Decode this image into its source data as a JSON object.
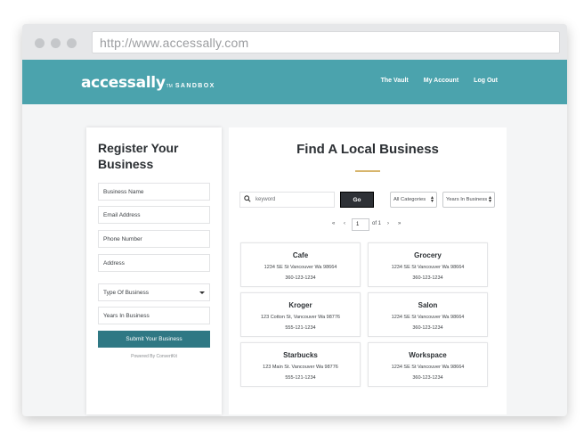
{
  "browser": {
    "url": "http://www.accessally.com"
  },
  "header": {
    "logo_text": "accessally",
    "logo_tm": "TM",
    "logo_sub": "SANDBOX",
    "nav": [
      "The Vault",
      "My Account",
      "Log Out"
    ]
  },
  "register": {
    "title": "Register Your Business",
    "fields": [
      "Business Name",
      "Email Address",
      "Phone Number",
      "Address"
    ],
    "type_select": "Type Of Business",
    "years_field": "Years In Business",
    "submit_label": "Submit Your Business",
    "powered_by": "Powered By ConvertKit"
  },
  "directory": {
    "title": "Find A Local Business",
    "search_placeholder": "keyword",
    "go_label": "Go",
    "categories_select": "All Categories",
    "years_select": "Years In Business",
    "pager": {
      "first": "«",
      "prev": "‹",
      "page": "1",
      "of_label": "of 1",
      "next": "›",
      "last": "»"
    },
    "businesses": [
      {
        "name": "Cafe",
        "address": "1234 SE St Vancouver Wa 98664",
        "phone": "360-123-1234"
      },
      {
        "name": "Grocery",
        "address": "1234 SE St Vancouver Wa 98664",
        "phone": "360-123-1234"
      },
      {
        "name": "Kroger",
        "address": "123 Cotton St, Vancouver Wa 98776",
        "phone": "555-121-1234"
      },
      {
        "name": "Salon",
        "address": "1234 SE St Vancouver Wa 98664",
        "phone": "360-123-1234"
      },
      {
        "name": "Starbucks",
        "address": "123 Main St. Vancouver Wa 98776",
        "phone": "555-121-1234"
      },
      {
        "name": "Workspace",
        "address": "1234 SE St Vancouver Wa 98664",
        "phone": "360-123-1234"
      }
    ]
  },
  "colors": {
    "header": "#4ba3ad",
    "submit": "#2f7884",
    "accent": "#d7b56c"
  }
}
